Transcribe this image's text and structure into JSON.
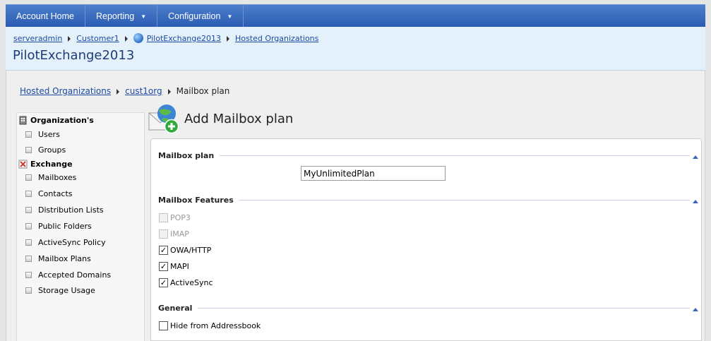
{
  "nav": {
    "items": [
      {
        "label": "Account Home",
        "dropdown": false
      },
      {
        "label": "Reporting",
        "dropdown": true
      },
      {
        "label": "Configuration",
        "dropdown": true
      }
    ]
  },
  "breadcrumb": {
    "items": [
      "serveradmin",
      "Customer1",
      "PilotExchange2013",
      "Hosted Organizations"
    ]
  },
  "page_title": "PilotExchange2013",
  "sub_breadcrumb": {
    "links": [
      "Hosted Organizations",
      "cust1org"
    ],
    "current": "Mailbox plan"
  },
  "sidebar": {
    "groups": [
      {
        "label": "Organization's",
        "icon": "building-icon",
        "items": [
          "Users",
          "Groups"
        ]
      },
      {
        "label": "Exchange",
        "icon": "exchange-icon",
        "items": [
          "Mailboxes",
          "Contacts",
          "Distribution Lists",
          "Public Folders",
          "ActiveSync Policy",
          "Mailbox Plans",
          "Accepted Domains",
          "Storage Usage"
        ]
      }
    ]
  },
  "main": {
    "title": "Add Mailbox plan",
    "sections": {
      "plan": {
        "label": "Mailbox plan",
        "input_value": "MyUnlimitedPlan"
      },
      "features": {
        "label": "Mailbox Features",
        "options": [
          {
            "label": "POP3",
            "checked": false,
            "disabled": true
          },
          {
            "label": "IMAP",
            "checked": false,
            "disabled": true
          },
          {
            "label": "OWA/HTTP",
            "checked": true,
            "disabled": false
          },
          {
            "label": "MAPI",
            "checked": true,
            "disabled": false
          },
          {
            "label": "ActiveSync",
            "checked": true,
            "disabled": false
          }
        ]
      },
      "general": {
        "label": "General",
        "options": [
          {
            "label": "Hide from Addressbook",
            "checked": false,
            "disabled": false
          }
        ]
      }
    }
  },
  "colors": {
    "nav_bg": "#2a5bb1",
    "header_bg": "#e4f1fb",
    "link": "#1c4aa3",
    "title": "#1d3c78"
  }
}
